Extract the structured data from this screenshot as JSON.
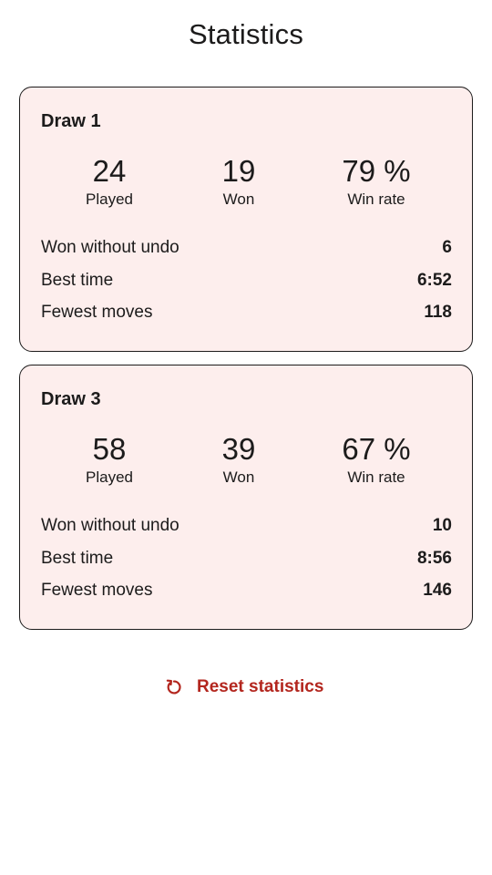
{
  "header": {
    "title": "Statistics"
  },
  "colors": {
    "card_background": "#fdeeed",
    "accent": "#b3261e",
    "text": "#1c1b1b"
  },
  "cards": [
    {
      "title": "Draw 1",
      "played_value": "24",
      "played_label": "Played",
      "won_value": "19",
      "won_label": "Won",
      "winrate_value": "79 %",
      "winrate_label": "Win rate",
      "rows": [
        {
          "label": "Won without undo",
          "value": "6"
        },
        {
          "label": "Best time",
          "value": "6:52"
        },
        {
          "label": "Fewest moves",
          "value": "118"
        }
      ]
    },
    {
      "title": "Draw 3",
      "played_value": "58",
      "played_label": "Played",
      "won_value": "39",
      "won_label": "Won",
      "winrate_value": "67 %",
      "winrate_label": "Win rate",
      "rows": [
        {
          "label": "Won without undo",
          "value": "10"
        },
        {
          "label": "Best time",
          "value": "8:56"
        },
        {
          "label": "Fewest moves",
          "value": "146"
        }
      ]
    }
  ],
  "reset": {
    "label": "Reset statistics",
    "icon": "reset-icon"
  }
}
